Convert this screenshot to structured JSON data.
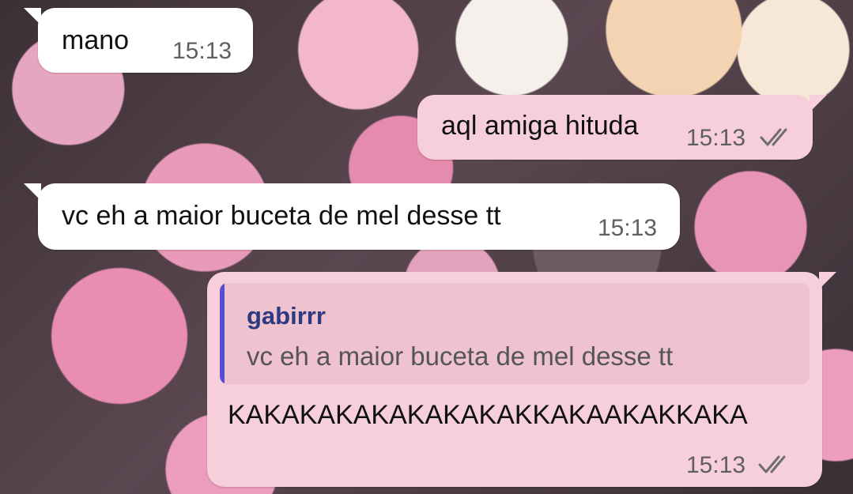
{
  "chat": {
    "messages": [
      {
        "direction": "in",
        "text": "mano",
        "time": "15:13"
      },
      {
        "direction": "out",
        "text": "aql amiga hituda",
        "time": "15:13",
        "status_icon": "double-check-icon"
      },
      {
        "direction": "in",
        "text": "vc eh a maior buceta de mel desse tt",
        "time": "15:13"
      },
      {
        "direction": "out",
        "reply_to": {
          "name": "gabirrr",
          "text": "vc eh a maior buceta de mel desse tt"
        },
        "text": "KAKAKAKAKAKAKAKAKKAKAAKAKKAKA",
        "time": "15:13",
        "status_icon": "double-check-icon"
      }
    ]
  },
  "colors": {
    "incoming_bubble": "#ffffff",
    "outgoing_bubble": "#f7cfdb",
    "quote_accent": "#5a4bd2",
    "quote_name": "#2e3a7f"
  }
}
